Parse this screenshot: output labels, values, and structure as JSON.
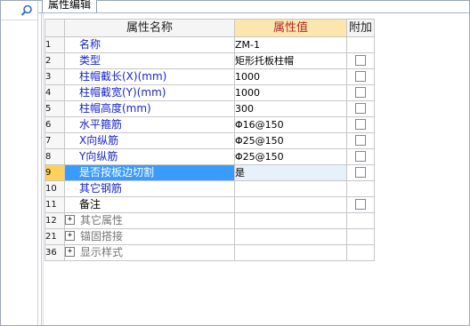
{
  "tab": {
    "label": "属性编辑"
  },
  "table": {
    "headers": {
      "name": "属性名称",
      "value": "属性值",
      "extra": "附加"
    },
    "rows": [
      {
        "num": "1",
        "name": "名称",
        "value": "ZM-1",
        "checkbox": false,
        "color": "blue"
      },
      {
        "num": "2",
        "name": "类型",
        "value": "矩形托板柱帽",
        "checkbox": true,
        "color": "blue"
      },
      {
        "num": "3",
        "name": "柱帽截长(X)(mm)",
        "value": "1000",
        "checkbox": true,
        "color": "blue"
      },
      {
        "num": "4",
        "name": "柱帽截宽(Y)(mm)",
        "value": "1000",
        "checkbox": true,
        "color": "blue"
      },
      {
        "num": "5",
        "name": "柱帽高度(mm)",
        "value": "300",
        "checkbox": true,
        "color": "blue"
      },
      {
        "num": "6",
        "name": "水平箍筋",
        "value": "Φ16@150",
        "checkbox": true,
        "color": "blue"
      },
      {
        "num": "7",
        "name": "X向纵筋",
        "value": "Φ25@150",
        "checkbox": true,
        "color": "blue"
      },
      {
        "num": "8",
        "name": "Y向纵筋",
        "value": "Φ25@150",
        "checkbox": true,
        "color": "blue"
      },
      {
        "num": "9",
        "name": "是否按板边切割",
        "value": "是",
        "checkbox": true,
        "color": "selected"
      },
      {
        "num": "10",
        "name": "其它钢筋",
        "value": "",
        "checkbox": false,
        "color": "blue"
      },
      {
        "num": "11",
        "name": "备注",
        "value": "",
        "checkbox": true,
        "color": "black"
      }
    ],
    "groups": [
      {
        "num": "12",
        "expander": "+",
        "name": "其它属性"
      },
      {
        "num": "21",
        "expander": "+",
        "name": "锚固搭接"
      },
      {
        "num": "36",
        "expander": "+",
        "name": "显示样式"
      }
    ]
  },
  "icons": {
    "search": "search-icon",
    "expand": "plus-expander-icon"
  },
  "colors": {
    "selected_row": "#3a9bff",
    "header_value_bg": "#fbe7ad",
    "header_value_text": "#b02a2a",
    "name_text": "#1a25c8",
    "group_text": "#777777"
  }
}
